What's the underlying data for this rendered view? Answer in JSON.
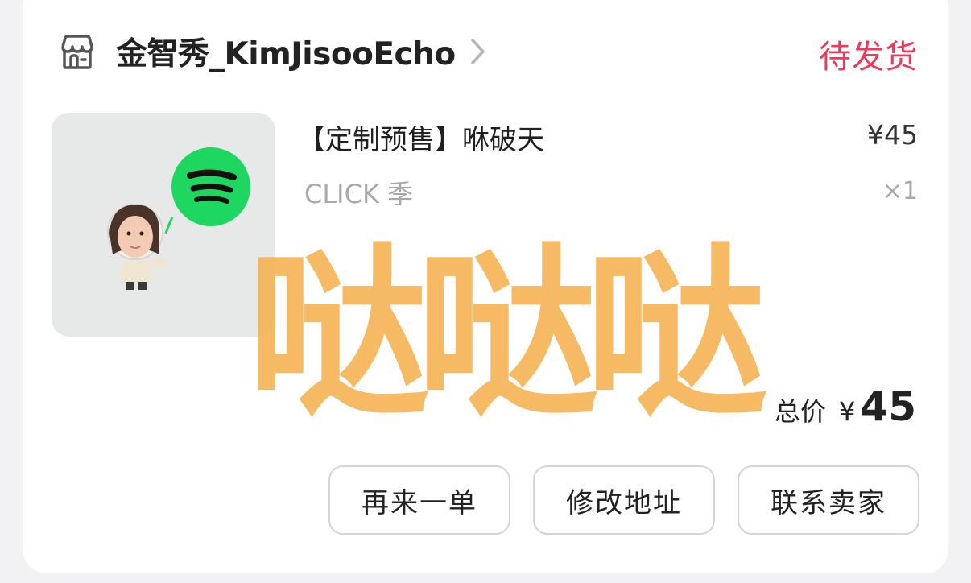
{
  "store": {
    "name": "金智秀_KimJisooEcho",
    "icon": "store-icon",
    "chevron_icon": "chevron-right-icon"
  },
  "order": {
    "status": "待发货"
  },
  "product": {
    "title": "【定制预售】咻破天",
    "price": "¥45",
    "sku": "CLICK 季",
    "quantity": "×1",
    "image_icon": "spotify-icon",
    "spotify_color": "#1ed760"
  },
  "summary": {
    "label": "总价",
    "currency": "¥",
    "amount": "45"
  },
  "actions": {
    "reorder": "再来一单",
    "modify_address": "修改地址",
    "contact_seller": "联系卖家"
  },
  "overlay": {
    "text": "哒哒哒",
    "color": "#f5b558"
  },
  "colors": {
    "status": "#ea3b5a",
    "background": "#f2f2f4"
  }
}
